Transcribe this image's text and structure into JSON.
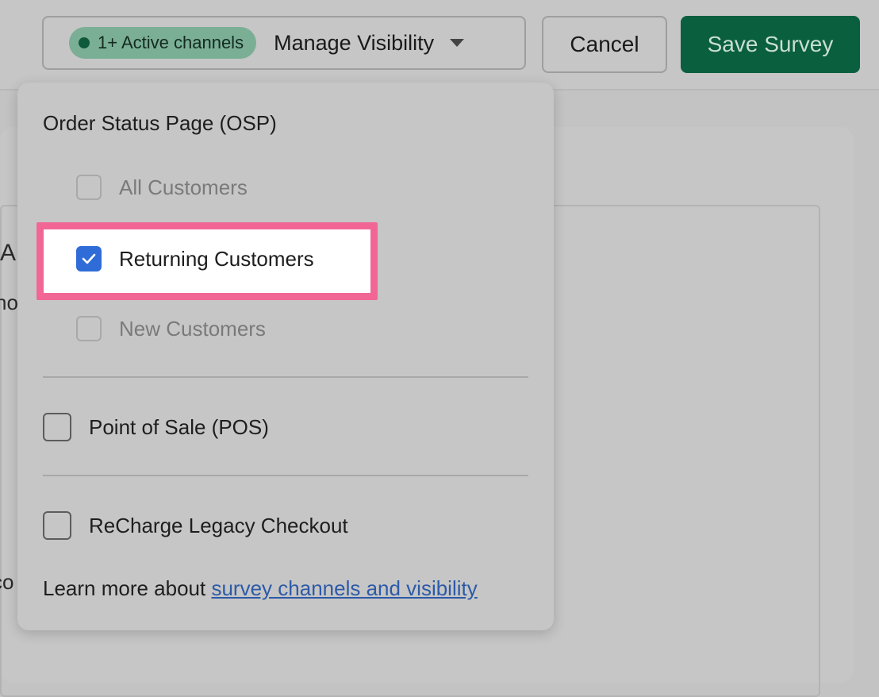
{
  "header": {
    "active_badge": "1+ Active channels",
    "manage_label": "Manage Visibility",
    "cancel_label": "Cancel",
    "save_label": "Save Survey"
  },
  "background": {
    "fragment_heading": "A",
    "fragment_line": "ho",
    "fragment_bottom": "co"
  },
  "dropdown": {
    "osp_title": "Order Status Page (OSP)",
    "osp_options": [
      {
        "label": "All Customers",
        "checked": false,
        "enabled": false
      },
      {
        "label": "Returning Customers",
        "checked": true,
        "enabled": true
      },
      {
        "label": "New Customers",
        "checked": false,
        "enabled": false
      }
    ],
    "pos_label": "Point of Sale (POS)",
    "recharge_label": "ReCharge Legacy Checkout",
    "learn_more_prefix": "Learn more about ",
    "learn_more_link": "survey channels and visibility"
  },
  "colors": {
    "save_button": "#0a5f3f",
    "active_badge": "#7aaf95",
    "checkbox_checked": "#2f6cd8",
    "highlight_border": "#f26695",
    "link": "#2c5aa8"
  }
}
